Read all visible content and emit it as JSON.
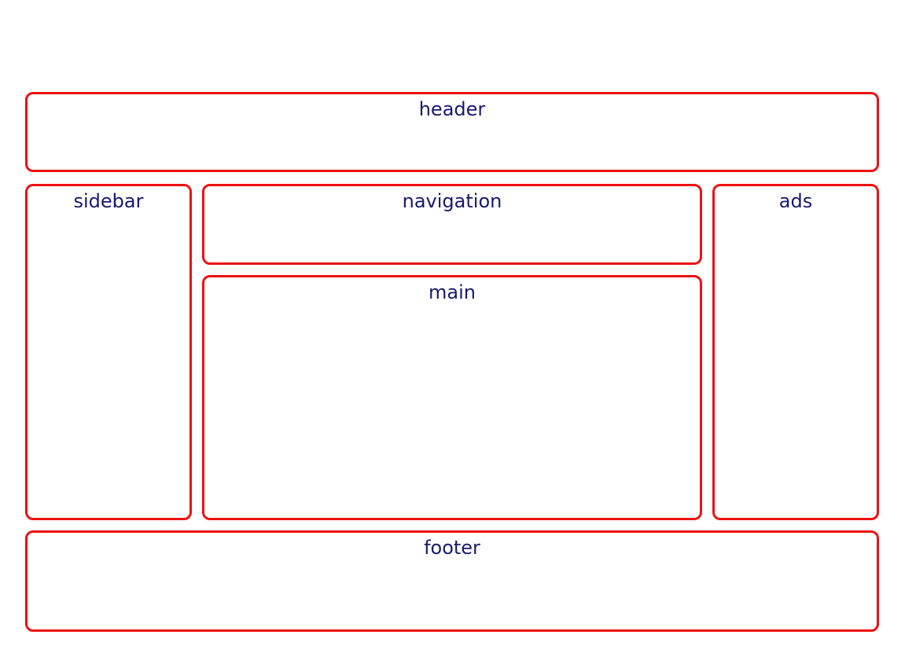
{
  "colors": {
    "border": "#ee1111",
    "text": "#191970",
    "background": "#ffffff"
  },
  "regions": {
    "header": "header",
    "sidebar": "sidebar",
    "navigation": "navigation",
    "ads": "ads",
    "main": "main",
    "footer": "footer"
  }
}
